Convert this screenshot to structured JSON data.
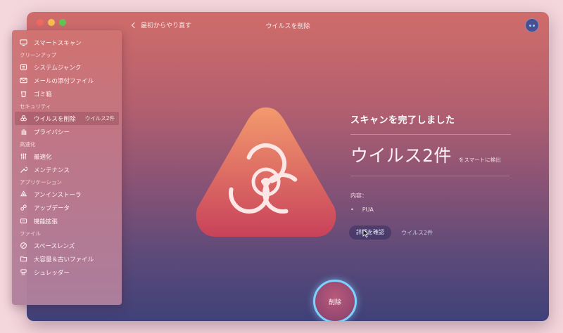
{
  "window": {
    "title": "ウイルスを削除",
    "back_label": "最初からやり直す"
  },
  "sidebar": {
    "top_item": "スマートスキャン",
    "sections": [
      {
        "title": "クリーンアップ",
        "items": [
          "システムジャンク",
          "メールの添付ファイル",
          "ゴミ箱"
        ]
      },
      {
        "title": "セキュリティ",
        "items": [
          "ウイルスを削除",
          "プライバシー"
        ]
      },
      {
        "title": "高速化",
        "items": [
          "最適化",
          "メンテナンス"
        ]
      },
      {
        "title": "アプリケーション",
        "items": [
          "アンインストーラ",
          "アップデータ",
          "機能拡張"
        ]
      },
      {
        "title": "ファイル",
        "items": [
          "スペースレンズ",
          "大容量＆古いファイル",
          "シュレッダー"
        ]
      }
    ],
    "active_badge": "ウイルス2件"
  },
  "result": {
    "heading": "スキャンを完了しました",
    "count": "ウイルス2件",
    "count_sub": "をスマートに検出",
    "content_label": "内容：",
    "content_bullet": "•",
    "content_item": "PUA"
  },
  "actions": {
    "review_label": "詳細を確認",
    "review_count": "ウイルス2件",
    "delete_label": "削除"
  },
  "colors": {
    "hazard_top": "#f08a6a",
    "hazard_bottom": "#c84658",
    "delete_ring": "#7fd2ff"
  }
}
